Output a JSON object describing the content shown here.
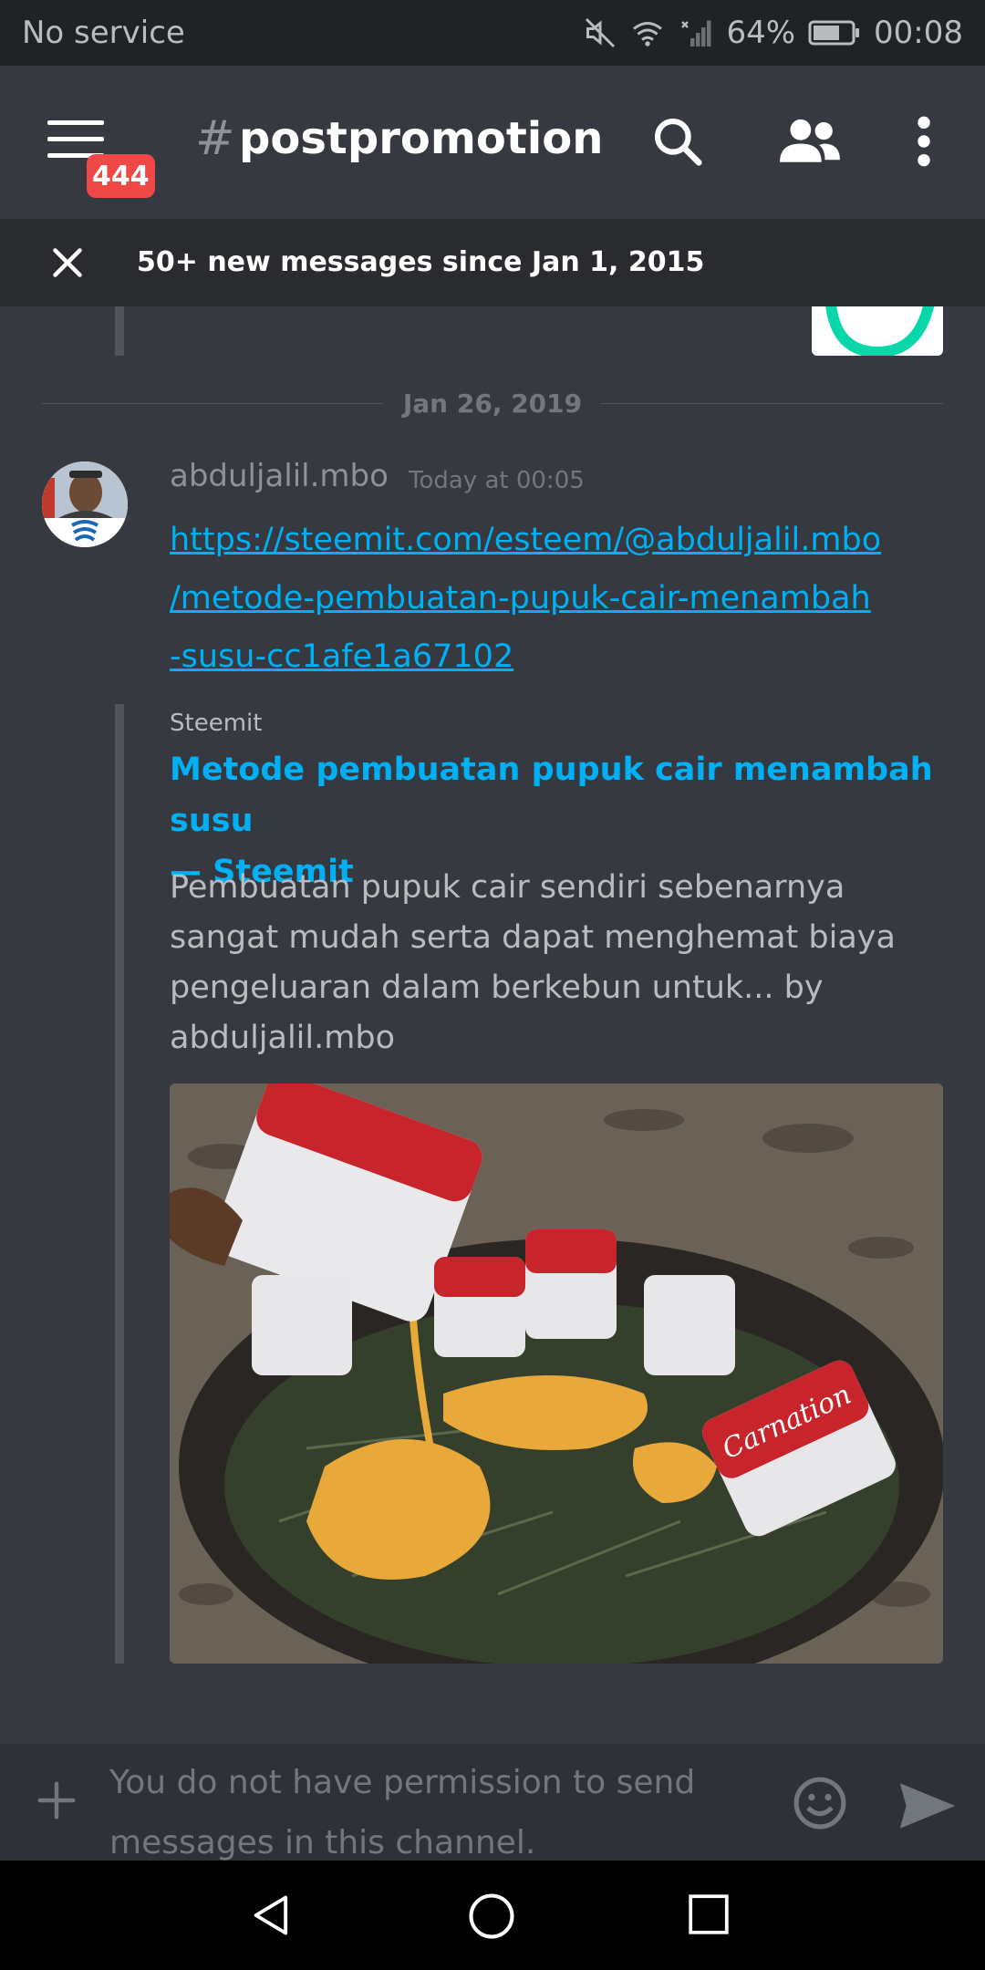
{
  "status_bar": {
    "carrier": "No service",
    "battery_percent": "64%",
    "time": "00:08"
  },
  "app_bar": {
    "unread_badge": "444",
    "channel_hash": "#",
    "channel_name": "postpromotion"
  },
  "banner": {
    "text": "50+ new messages since Jan 1, 2015"
  },
  "divider": {
    "date": "Jan 26, 2019"
  },
  "message": {
    "author": "abduljalil.mbo",
    "timestamp": "Today at 00:05",
    "link_lines": [
      "https://steemit.com/esteem/@abduljalil.mbo",
      "/metode-pembuatan-pupuk-cair-menambah",
      "-susu-cc1afe1a67102"
    ]
  },
  "embed": {
    "provider": "Steemit",
    "title_lines": [
      "Metode pembuatan pupuk cair menambah susu",
      "— Steemit"
    ],
    "description_lines": [
      "Pembuatan pupuk cair sendiri sebenarnya",
      "sangat mudah serta dapat menghemat biaya",
      "pengeluaran dalam berkebun untuk... by",
      "abduljalil.mbo"
    ],
    "image_can_label": "Carnation"
  },
  "composer": {
    "placeholder_lines": [
      "You do not have permission to send",
      "messages in this channel."
    ]
  },
  "colors": {
    "background": "#36393f",
    "link": "#00b0f4",
    "badge": "#f04747",
    "status_bar": "#202225"
  }
}
